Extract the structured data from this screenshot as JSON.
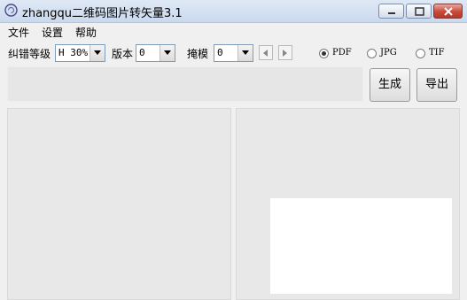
{
  "window": {
    "title": "zhangqu二维码图片转矢量3.1"
  },
  "menu": [
    "文件",
    "设置",
    "帮助"
  ],
  "toolbar": {
    "ec_label": "纠错等级",
    "ec_value": "H 30%",
    "version_label": "版本",
    "version_value": "0",
    "mask_label": "掩模",
    "mask_value": "0",
    "formats": [
      {
        "label": "PDF",
        "selected": true
      },
      {
        "label": "JPG",
        "selected": false
      },
      {
        "label": "TIF",
        "selected": false
      }
    ]
  },
  "buttons": {
    "generate": "生成",
    "export": "导出"
  },
  "icons": {
    "app": "app-spiral-icon",
    "minimize": "minimize-icon",
    "maximize": "maximize-icon",
    "close": "close-icon"
  }
}
